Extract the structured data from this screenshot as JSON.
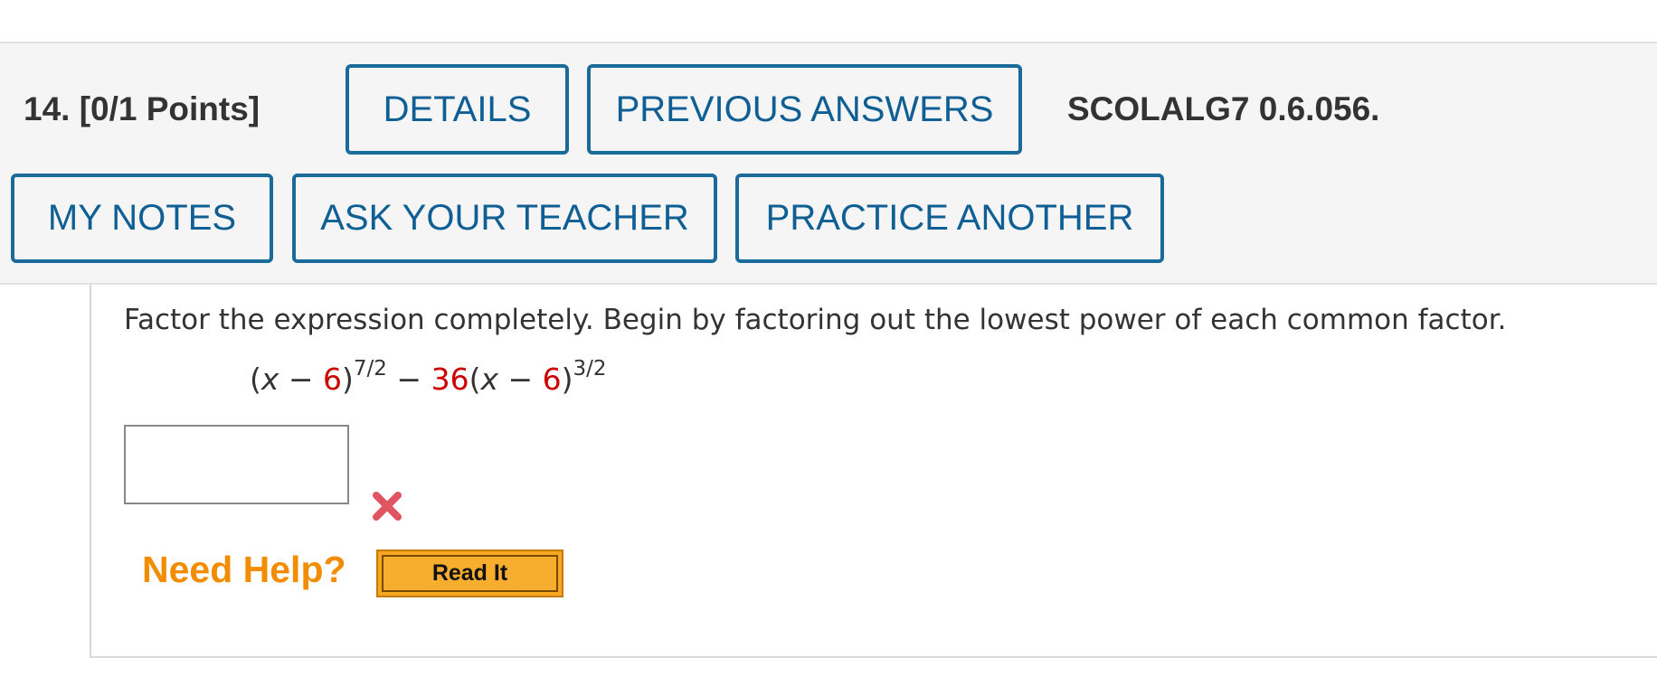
{
  "question": {
    "number_label": "14.  [0/1 Points]",
    "code": "SCOLALG7 0.6.056."
  },
  "buttons": {
    "details": "DETAILS",
    "previous_answers": "PREVIOUS ANSWERS",
    "my_notes": "MY NOTES",
    "ask_teacher": "ASK YOUR TEACHER",
    "practice_another": "PRACTICE ANOTHER"
  },
  "problem": {
    "instructions": "Factor the expression completely. Begin by factoring out the lowest power of each common factor.",
    "expression": {
      "open_paren_1": "(",
      "var_1": "x",
      "minus_1": " − ",
      "const_1": "6",
      "close_paren_1": ")",
      "exp_1": "7/2",
      "minus_2": " − ",
      "coef": "36",
      "open_paren_2": "(",
      "var_2": "x",
      "minus_3": " − ",
      "const_2": "6",
      "close_paren_2": ")",
      "exp_2": "3/2"
    },
    "answer_value": "",
    "status_icon": "red-x-icon"
  },
  "help": {
    "label": "Need Help?",
    "read_it": "Read It"
  },
  "colors": {
    "button_border": "#1a6a9a",
    "button_text": "#0f5f94",
    "red_value": "#cc0000",
    "need_help": "#f28c00",
    "read_it_bg": "#f5a623",
    "wrong_icon": "#e05560"
  }
}
